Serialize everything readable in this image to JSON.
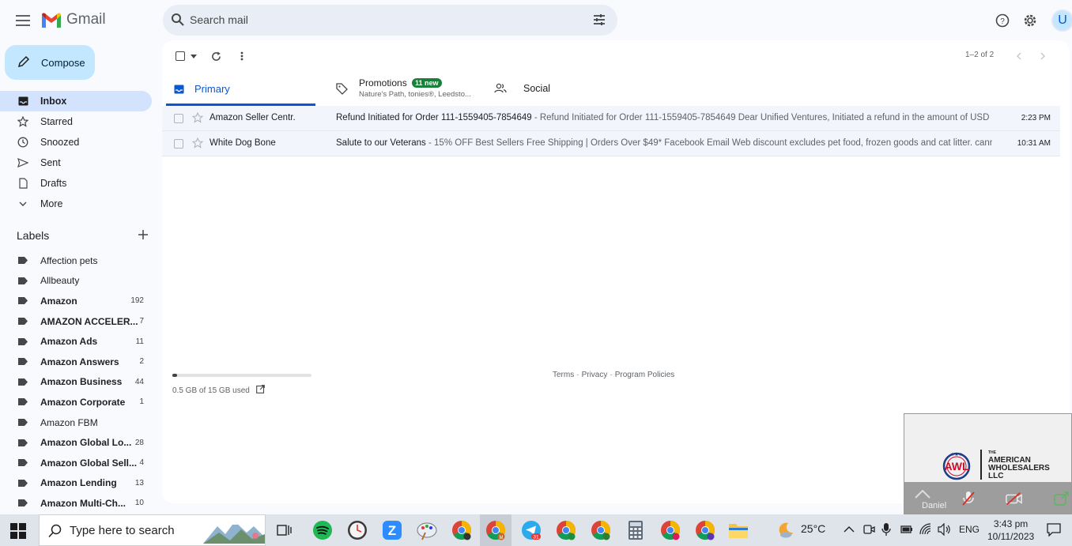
{
  "header": {
    "app_name": "Gmail",
    "search_placeholder": "Search mail",
    "avatar_letter": "U"
  },
  "sidebar": {
    "compose_label": "Compose",
    "nav": [
      {
        "label": "Inbox",
        "icon": "inbox-icon",
        "active": true
      },
      {
        "label": "Starred",
        "icon": "star-icon"
      },
      {
        "label": "Snoozed",
        "icon": "clock-icon"
      },
      {
        "label": "Sent",
        "icon": "send-icon"
      },
      {
        "label": "Drafts",
        "icon": "draft-icon"
      },
      {
        "label": "More",
        "icon": "chevron-down-icon"
      }
    ],
    "labels_title": "Labels",
    "labels": [
      {
        "name": "Affection pets",
        "count": "",
        "bold": false
      },
      {
        "name": "Allbeauty",
        "count": "",
        "bold": false
      },
      {
        "name": "Amazon",
        "count": "192",
        "bold": true
      },
      {
        "name": "AMAZON ACCELER...",
        "count": "7",
        "bold": true
      },
      {
        "name": "Amazon Ads",
        "count": "11",
        "bold": true
      },
      {
        "name": "Amazon Answers",
        "count": "2",
        "bold": true
      },
      {
        "name": "Amazon Business",
        "count": "44",
        "bold": true
      },
      {
        "name": "Amazon Corporate",
        "count": "1",
        "bold": true
      },
      {
        "name": "Amazon FBM",
        "count": "",
        "bold": false
      },
      {
        "name": "Amazon Global Lo...",
        "count": "28",
        "bold": true
      },
      {
        "name": "Amazon Global Sell...",
        "count": "4",
        "bold": true
      },
      {
        "name": "Amazon Lending",
        "count": "13",
        "bold": true
      },
      {
        "name": "Amazon Multi-Ch...",
        "count": "10",
        "bold": true
      }
    ]
  },
  "toolbar": {
    "pager_text": "1–2 of 2"
  },
  "tabs": {
    "primary": "Primary",
    "promotions": "Promotions",
    "promotions_badge": "11 new",
    "promotions_sub": "Nature's Path, tonies®, Leedsto...",
    "social": "Social"
  },
  "emails": [
    {
      "sender": "Amazon Seller Centr.",
      "subject": "Refund Initiated for Order 111-1559405-7854649",
      "snippet": " - Refund Initiated for Order 111-1559405-7854649 Dear Unified Ventures, Initiated a refund in the amount of USD ...",
      "time": "2:23 PM"
    },
    {
      "sender": "White Dog Bone",
      "subject": "Salute to our Veterans",
      "snippet": " - 15% OFF Best Sellers Free Shipping | Orders Over $49* Facebook Email Web discount excludes pet food, frozen goods and cat litter. cann...",
      "time": "10:31 AM"
    }
  ],
  "storage": {
    "text": "0.5 GB of 15 GB used",
    "used_fraction": 0.033
  },
  "footer": {
    "terms": "Terms",
    "privacy": "Privacy",
    "policies": "Program Policies",
    "sep": "·"
  },
  "video": {
    "logo_small": "THE",
    "logo_line1": "AMERICAN",
    "logo_line2": "WHOLESALERS",
    "logo_line3": "LLC",
    "logo_mark": "AWL",
    "participant": "Daniel"
  },
  "taskbar": {
    "search_text": "Type here to search",
    "weather": "25°C",
    "lang": "ENG",
    "time": "3:43 pm",
    "date": "10/11/2023",
    "telegram_badge": "31"
  },
  "colors": {
    "accent": "#0b57d0",
    "compose_bg": "#c2e7ff",
    "active_nav": "#d3e3fd",
    "badge_green": "#188038"
  }
}
